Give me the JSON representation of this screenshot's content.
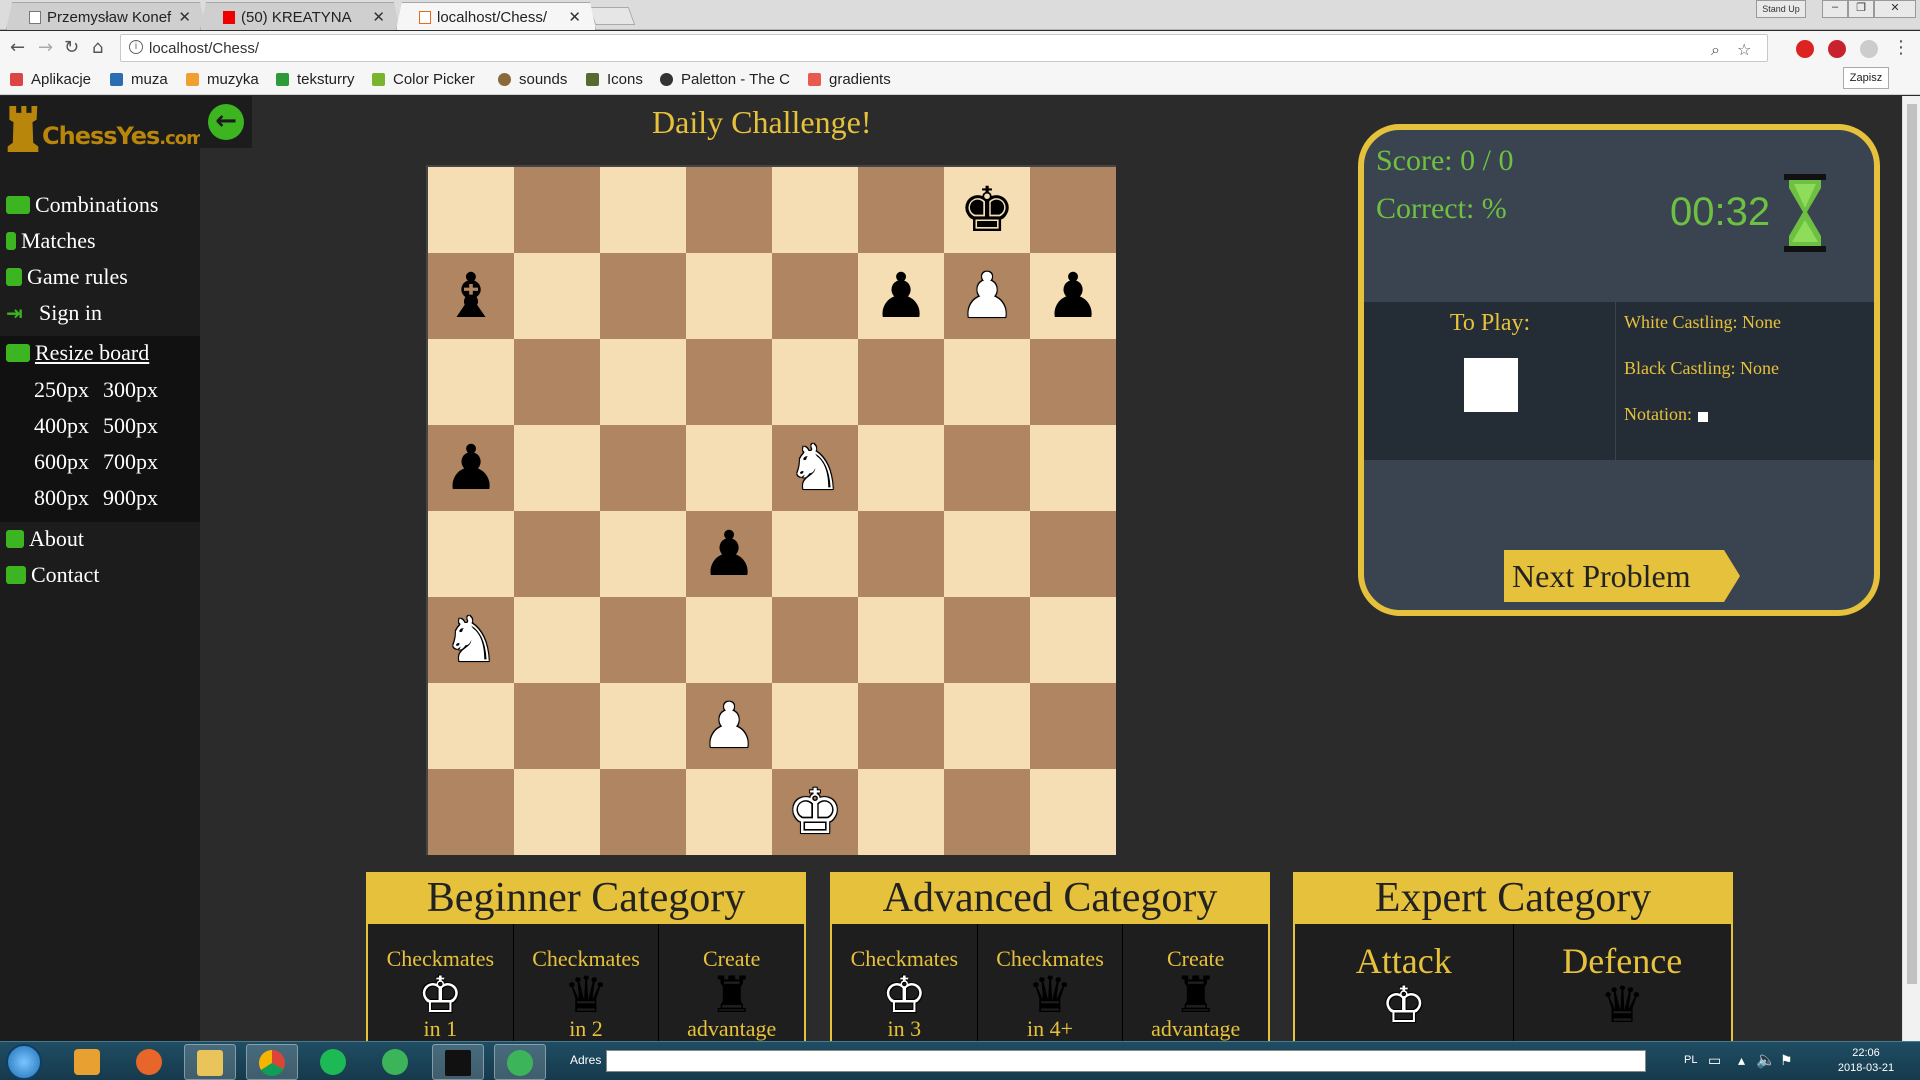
{
  "browser": {
    "tabs": [
      {
        "title": "Przemysław Konef"
      },
      {
        "title": "(50) KREATYNA"
      },
      {
        "title": "localhost/Chess/"
      }
    ],
    "window_badge": "Stand Up",
    "url": "localhost/Chess/",
    "bookmarks": [
      {
        "label": "Aplikacje",
        "color": "#d44"
      },
      {
        "label": "muza",
        "color": "#2a6db3"
      },
      {
        "label": "muzyka",
        "color": "#f0a030"
      },
      {
        "label": "teksturry",
        "color": "#2e9b3a"
      },
      {
        "label": "Color Picker",
        "color": "#7ab32e"
      },
      {
        "label": "sounds",
        "color": "#8a6a3a"
      },
      {
        "label": "Icons",
        "color": "#556b2f"
      },
      {
        "label": "Paletton - The C",
        "color": "#333"
      },
      {
        "label": "gradients",
        "color": "#e85a4f"
      }
    ],
    "save_label": "Zapisz"
  },
  "site": {
    "logo_main": "ChessYes",
    "logo_tld": ".com",
    "menu": [
      {
        "label": "Combinations"
      },
      {
        "label": "Matches"
      },
      {
        "label": "Game rules"
      },
      {
        "label": "Sign in"
      }
    ],
    "resize_label": "Resize board",
    "sizes": [
      [
        "250px",
        "300px"
      ],
      [
        "400px",
        "500px"
      ],
      [
        "600px",
        "700px"
      ],
      [
        "800px",
        "900px"
      ]
    ],
    "menu_bottom": [
      {
        "label": "About"
      },
      {
        "label": "Contact"
      }
    ]
  },
  "challenge": {
    "title": "Daily Challenge!"
  },
  "board": {
    "light_color": "#f5deb3",
    "dark_color": "#b08561",
    "rows": [
      [
        "",
        "",
        "",
        "",
        "",
        "",
        "bK",
        ""
      ],
      [
        "bB",
        "",
        "",
        "",
        "",
        "bP",
        "wP",
        "bP"
      ],
      [
        "",
        "",
        "",
        "",
        "",
        "",
        "",
        ""
      ],
      [
        "bP",
        "",
        "",
        "",
        "wN",
        "",
        "",
        ""
      ],
      [
        "",
        "",
        "",
        "bP",
        "",
        "",
        "",
        ""
      ],
      [
        "wN",
        "",
        "",
        "",
        "",
        "",
        "",
        ""
      ],
      [
        "",
        "",
        "",
        "wP",
        "",
        "",
        "",
        ""
      ],
      [
        "",
        "",
        "",
        "",
        "wK",
        "",
        "",
        ""
      ]
    ]
  },
  "panel": {
    "score_label": "Score: 0 / 0",
    "correct_label": "Correct: %",
    "timer_min": "00",
    "timer_sec": "32",
    "to_play_label": "To Play:",
    "white_castling": "White Castling: None",
    "black_castling": "Black Castling: None",
    "notation_label": "Notation:",
    "next_button": "Next Problem"
  },
  "categories": [
    {
      "title": "Beginner Category",
      "items": [
        {
          "label": "Checkmates",
          "sub": "in 1",
          "piece": "♔",
          "white": true
        },
        {
          "label": "Checkmates",
          "sub": "in 2",
          "piece": "♛",
          "white": false
        },
        {
          "label": "Create",
          "sub": "advantage",
          "piece": "♜",
          "white": false
        }
      ]
    },
    {
      "title": "Advanced Category",
      "items": [
        {
          "label": "Checkmates",
          "sub": "in 3",
          "piece": "♔",
          "white": true
        },
        {
          "label": "Checkmates",
          "sub": "in 4+",
          "piece": "♛",
          "white": false
        },
        {
          "label": "Create",
          "sub": "advantage",
          "piece": "♜",
          "white": false
        }
      ]
    },
    {
      "title": "Expert Category",
      "items": [
        {
          "label": "Attack",
          "sub": "",
          "piece": "♔",
          "white": true
        },
        {
          "label": "Defence",
          "sub": "",
          "piece": "♛",
          "white": false
        }
      ]
    }
  ],
  "taskbar": {
    "address_label": "Adres",
    "lang": "PL",
    "time": "22:06",
    "date": "2018-03-21"
  }
}
